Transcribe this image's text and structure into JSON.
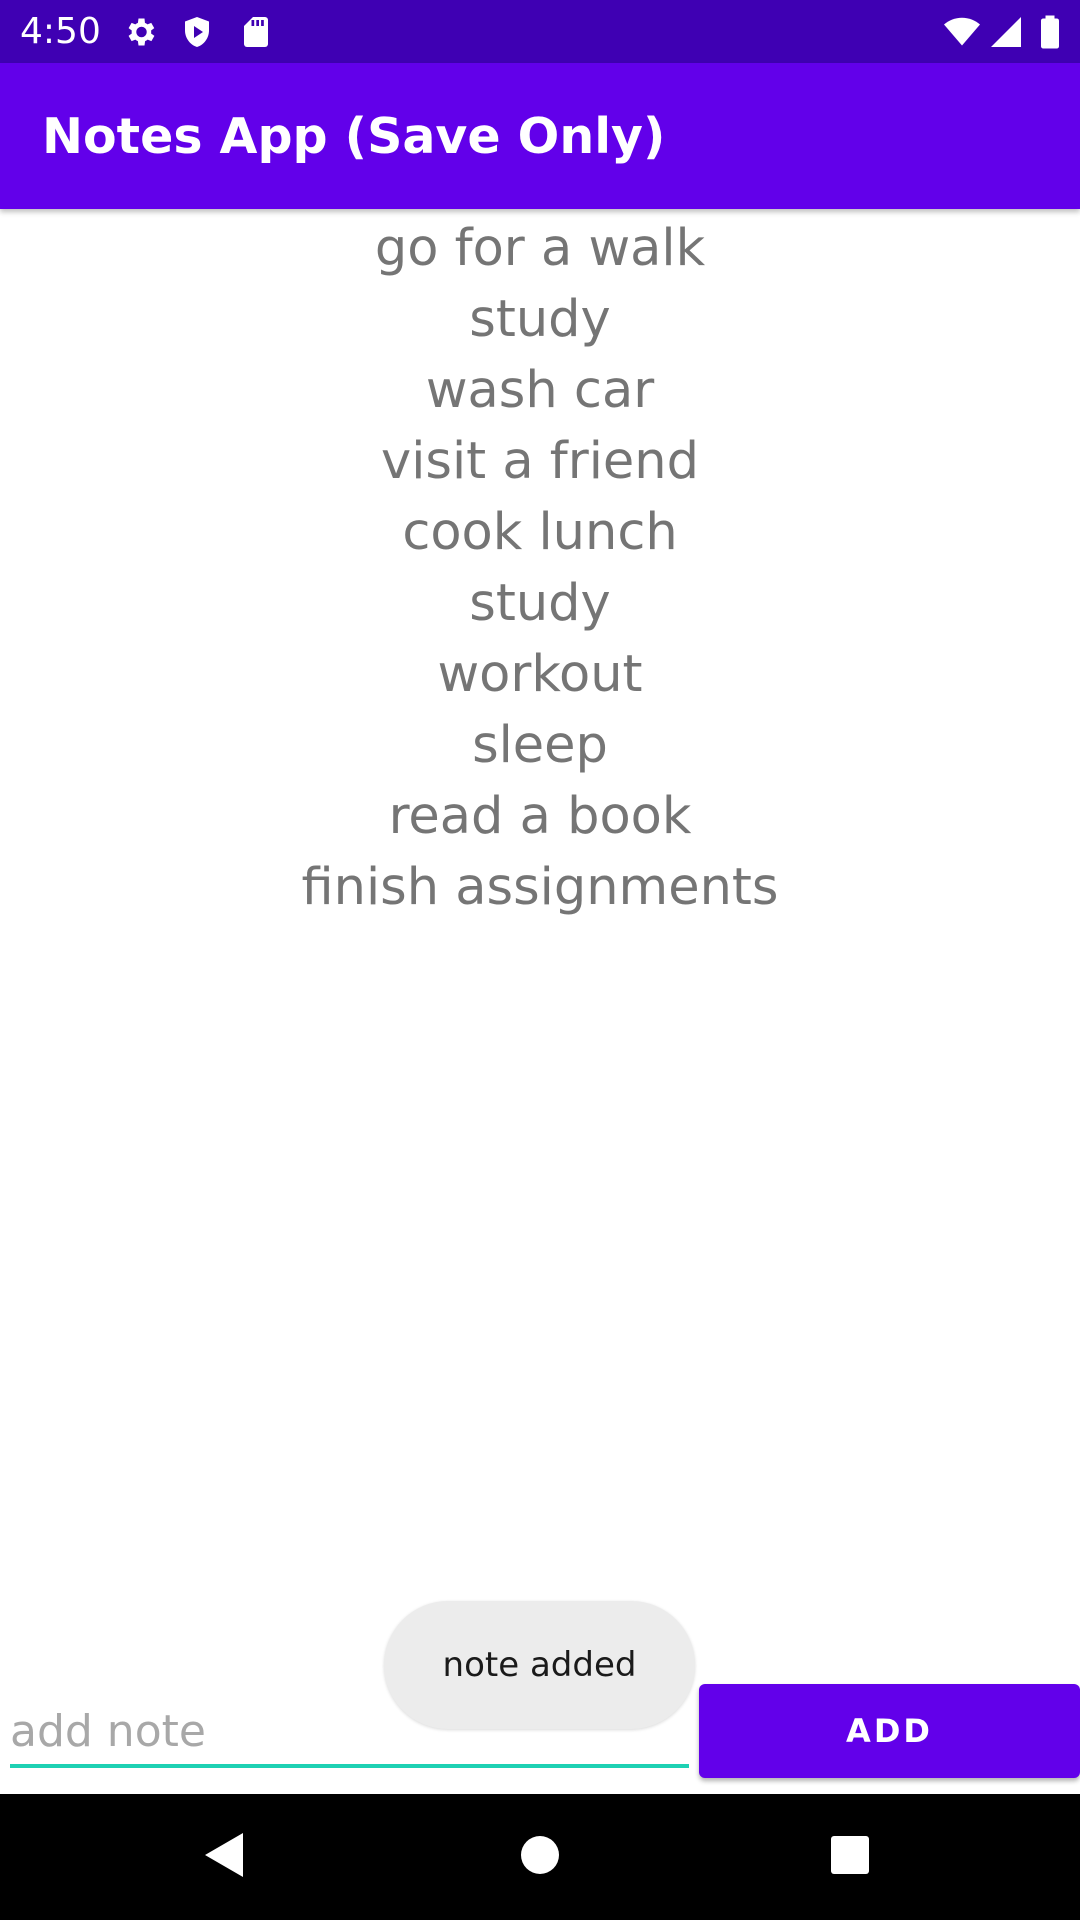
{
  "status_bar": {
    "time": "4:50",
    "left_icons": [
      "gear-icon",
      "shield-icon",
      "sd-card-icon"
    ],
    "right_icons": [
      "wifi-icon",
      "signal-icon",
      "battery-icon"
    ]
  },
  "app_bar": {
    "title": "Notes App (Save Only)",
    "color": "#6200ea"
  },
  "notes": [
    "go for a walk",
    "study",
    "wash car",
    "visit a friend",
    "cook lunch",
    "study",
    "workout",
    "sleep",
    "read a book",
    "finish assignments"
  ],
  "toast": {
    "text": "note added"
  },
  "input": {
    "value": "",
    "placeholder": "add note",
    "underline_color": "#1dd1b3"
  },
  "add_button": {
    "label": "ADD"
  },
  "nav_bar": {
    "icons": [
      "back-icon",
      "home-icon",
      "recents-icon"
    ]
  }
}
